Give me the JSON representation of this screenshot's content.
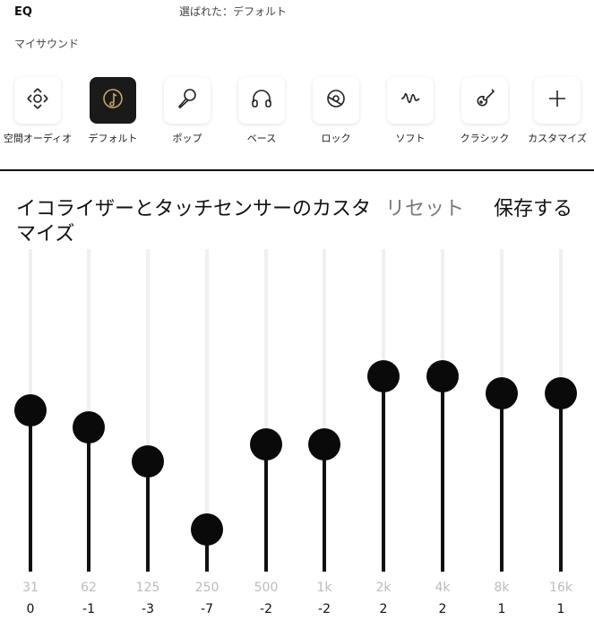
{
  "header": {
    "title": "EQ",
    "selected_text": "選ばれた：デフォルト",
    "section_label": "マイサウンド"
  },
  "presets": [
    {
      "label": "空間オーディオ",
      "icon": "spatial-audio-icon",
      "active": false
    },
    {
      "label": "デフォルト",
      "icon": "default-music-icon",
      "active": true
    },
    {
      "label": "ポップ",
      "icon": "microphone-icon",
      "active": false
    },
    {
      "label": "ベース",
      "icon": "headphones-icon",
      "active": false
    },
    {
      "label": "ロック",
      "icon": "rock-disc-icon",
      "active": false
    },
    {
      "label": "ソフト",
      "icon": "soft-wave-icon",
      "active": false
    },
    {
      "label": "クラシック",
      "icon": "guitar-icon",
      "active": false
    },
    {
      "label": "カスタマイズ",
      "icon": "plus-icon",
      "active": false
    }
  ],
  "eq": {
    "title": "イコライザーとタッチセンサーのカスタマイズ",
    "reset_label": "リセット",
    "save_label": "保存する",
    "range": [
      -10,
      10
    ],
    "bands": [
      {
        "freq": "31",
        "gain": "0"
      },
      {
        "freq": "62",
        "gain": "-1"
      },
      {
        "freq": "125",
        "gain": "-3"
      },
      {
        "freq": "250",
        "gain": "-7"
      },
      {
        "freq": "500",
        "gain": "-2"
      },
      {
        "freq": "1k",
        "gain": "-2"
      },
      {
        "freq": "2k",
        "gain": "2"
      },
      {
        "freq": "4k",
        "gain": "2"
      },
      {
        "freq": "8k",
        "gain": "1"
      },
      {
        "freq": "16k",
        "gain": "1"
      }
    ]
  },
  "colors": {
    "active_tile": "#1a1a1a",
    "active_icon": "#c9a36b",
    "slider": "#111111",
    "track": "#f0f0f0"
  }
}
